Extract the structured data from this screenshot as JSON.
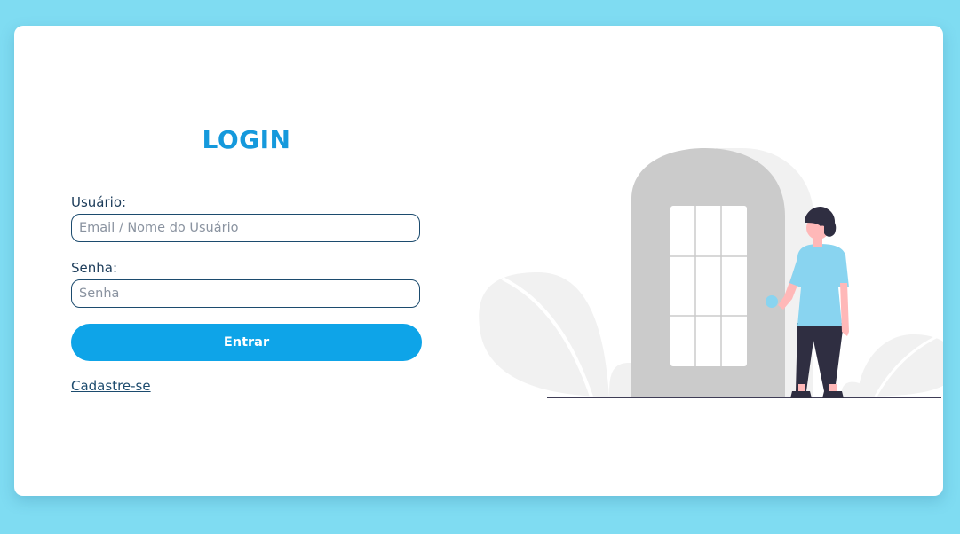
{
  "login": {
    "title": "LOGIN",
    "username_label": "Usuário:",
    "username_placeholder": "Email / Nome do Usuário",
    "username_value": "",
    "password_label": "Senha:",
    "password_placeholder": "Senha",
    "password_value": "",
    "submit_label": "Entrar",
    "register_link": "Cadastre-se"
  },
  "colors": {
    "background": "#7fdcf2",
    "accent": "#1599dc",
    "button": "#0ea4e8",
    "text_dark": "#1c3c5a"
  },
  "illustration": {
    "icon": "person-at-door-illustration"
  }
}
